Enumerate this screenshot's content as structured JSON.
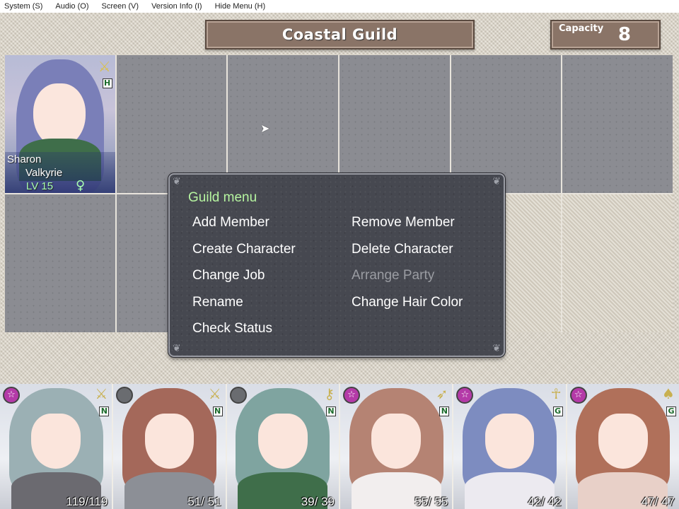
{
  "menubar": {
    "items": [
      "System (S)",
      "Audio (O)",
      "Screen (V)",
      "Version Info (I)",
      "Hide Menu (H)"
    ]
  },
  "header": {
    "title": "Coastal Guild",
    "capacity_label": "Capacity",
    "capacity_value": "8"
  },
  "roster": {
    "slots": [
      {
        "name": "Sharon",
        "class": "Valkyrie",
        "level": "LV 15",
        "gender": "♀",
        "rank": "H",
        "weapon_icon": "sword-icon",
        "hair_color": "#7a7fb8"
      }
    ]
  },
  "guild_menu": {
    "heading": "Guild menu",
    "items": [
      {
        "label": "Add Member",
        "enabled": true
      },
      {
        "label": "Remove Member",
        "enabled": true
      },
      {
        "label": "Create Character",
        "enabled": true
      },
      {
        "label": "Delete Character",
        "enabled": true
      },
      {
        "label": "Change Job",
        "enabled": true
      },
      {
        "label": "Arrange Party",
        "enabled": false
      },
      {
        "label": "Rename",
        "enabled": true
      },
      {
        "label": "Change Hair Color",
        "enabled": true
      },
      {
        "label": "Check Status",
        "enabled": true
      }
    ]
  },
  "party": [
    {
      "hp": "119/119",
      "rank": "N",
      "weapon_icon": "sword-icon",
      "badge": "star",
      "hair_color": "#9bb0b4",
      "body_color": "#6b6a70"
    },
    {
      "hp": "51/ 51",
      "rank": "N",
      "weapon_icon": "sword-icon",
      "badge": "empty",
      "hair_color": "#a4685a",
      "body_color": "#8c8f96"
    },
    {
      "hp": "39/ 39",
      "rank": "N",
      "weapon_icon": "key-icon",
      "badge": "empty",
      "hair_color": "#7fa4a0",
      "body_color": "#3f6e4a"
    },
    {
      "hp": "55/ 55",
      "rank": "N",
      "weapon_icon": "bow-icon",
      "badge": "star",
      "hair_color": "#b58373",
      "body_color": "#f2eeee"
    },
    {
      "hp": "42/ 42",
      "rank": "G",
      "weapon_icon": "ankh-icon",
      "badge": "star",
      "hair_color": "#7d8cc0",
      "body_color": "#eceaf0"
    },
    {
      "hp": "47/ 47",
      "rank": "G",
      "weapon_icon": "hat-icon",
      "badge": "star",
      "hair_color": "#b0705a",
      "body_color": "#e8d0c8"
    }
  ],
  "colors": {
    "plaque": "#8a7467",
    "menu_heading": "#b6f5a0",
    "disabled_item": "#9a9ca2",
    "level_text": "#a8ffb0",
    "star_badge": "#b43aa8"
  }
}
